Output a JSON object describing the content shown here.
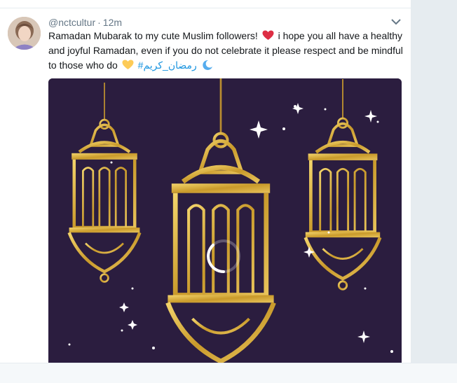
{
  "tweet": {
    "handle": "@nctcultur",
    "separator": "·",
    "time": "12m",
    "text_part1": "Ramadan Mubarak to my cute Muslim followers!",
    "text_part2": "i hope you all have a healthy and joyful Ramadan, even if you do not celebrate it please respect and be mindful to those who do",
    "hashtag": "#رمضان_كريم",
    "emojis": [
      "red-heart-icon",
      "yellow-heart-icon",
      "crescent-moon-icon"
    ]
  },
  "colors": {
    "link": "#1b95e0",
    "text": "#14171a",
    "muted": "#657786",
    "media_bg": "#2b1d3f",
    "gold": "#c9a233"
  }
}
